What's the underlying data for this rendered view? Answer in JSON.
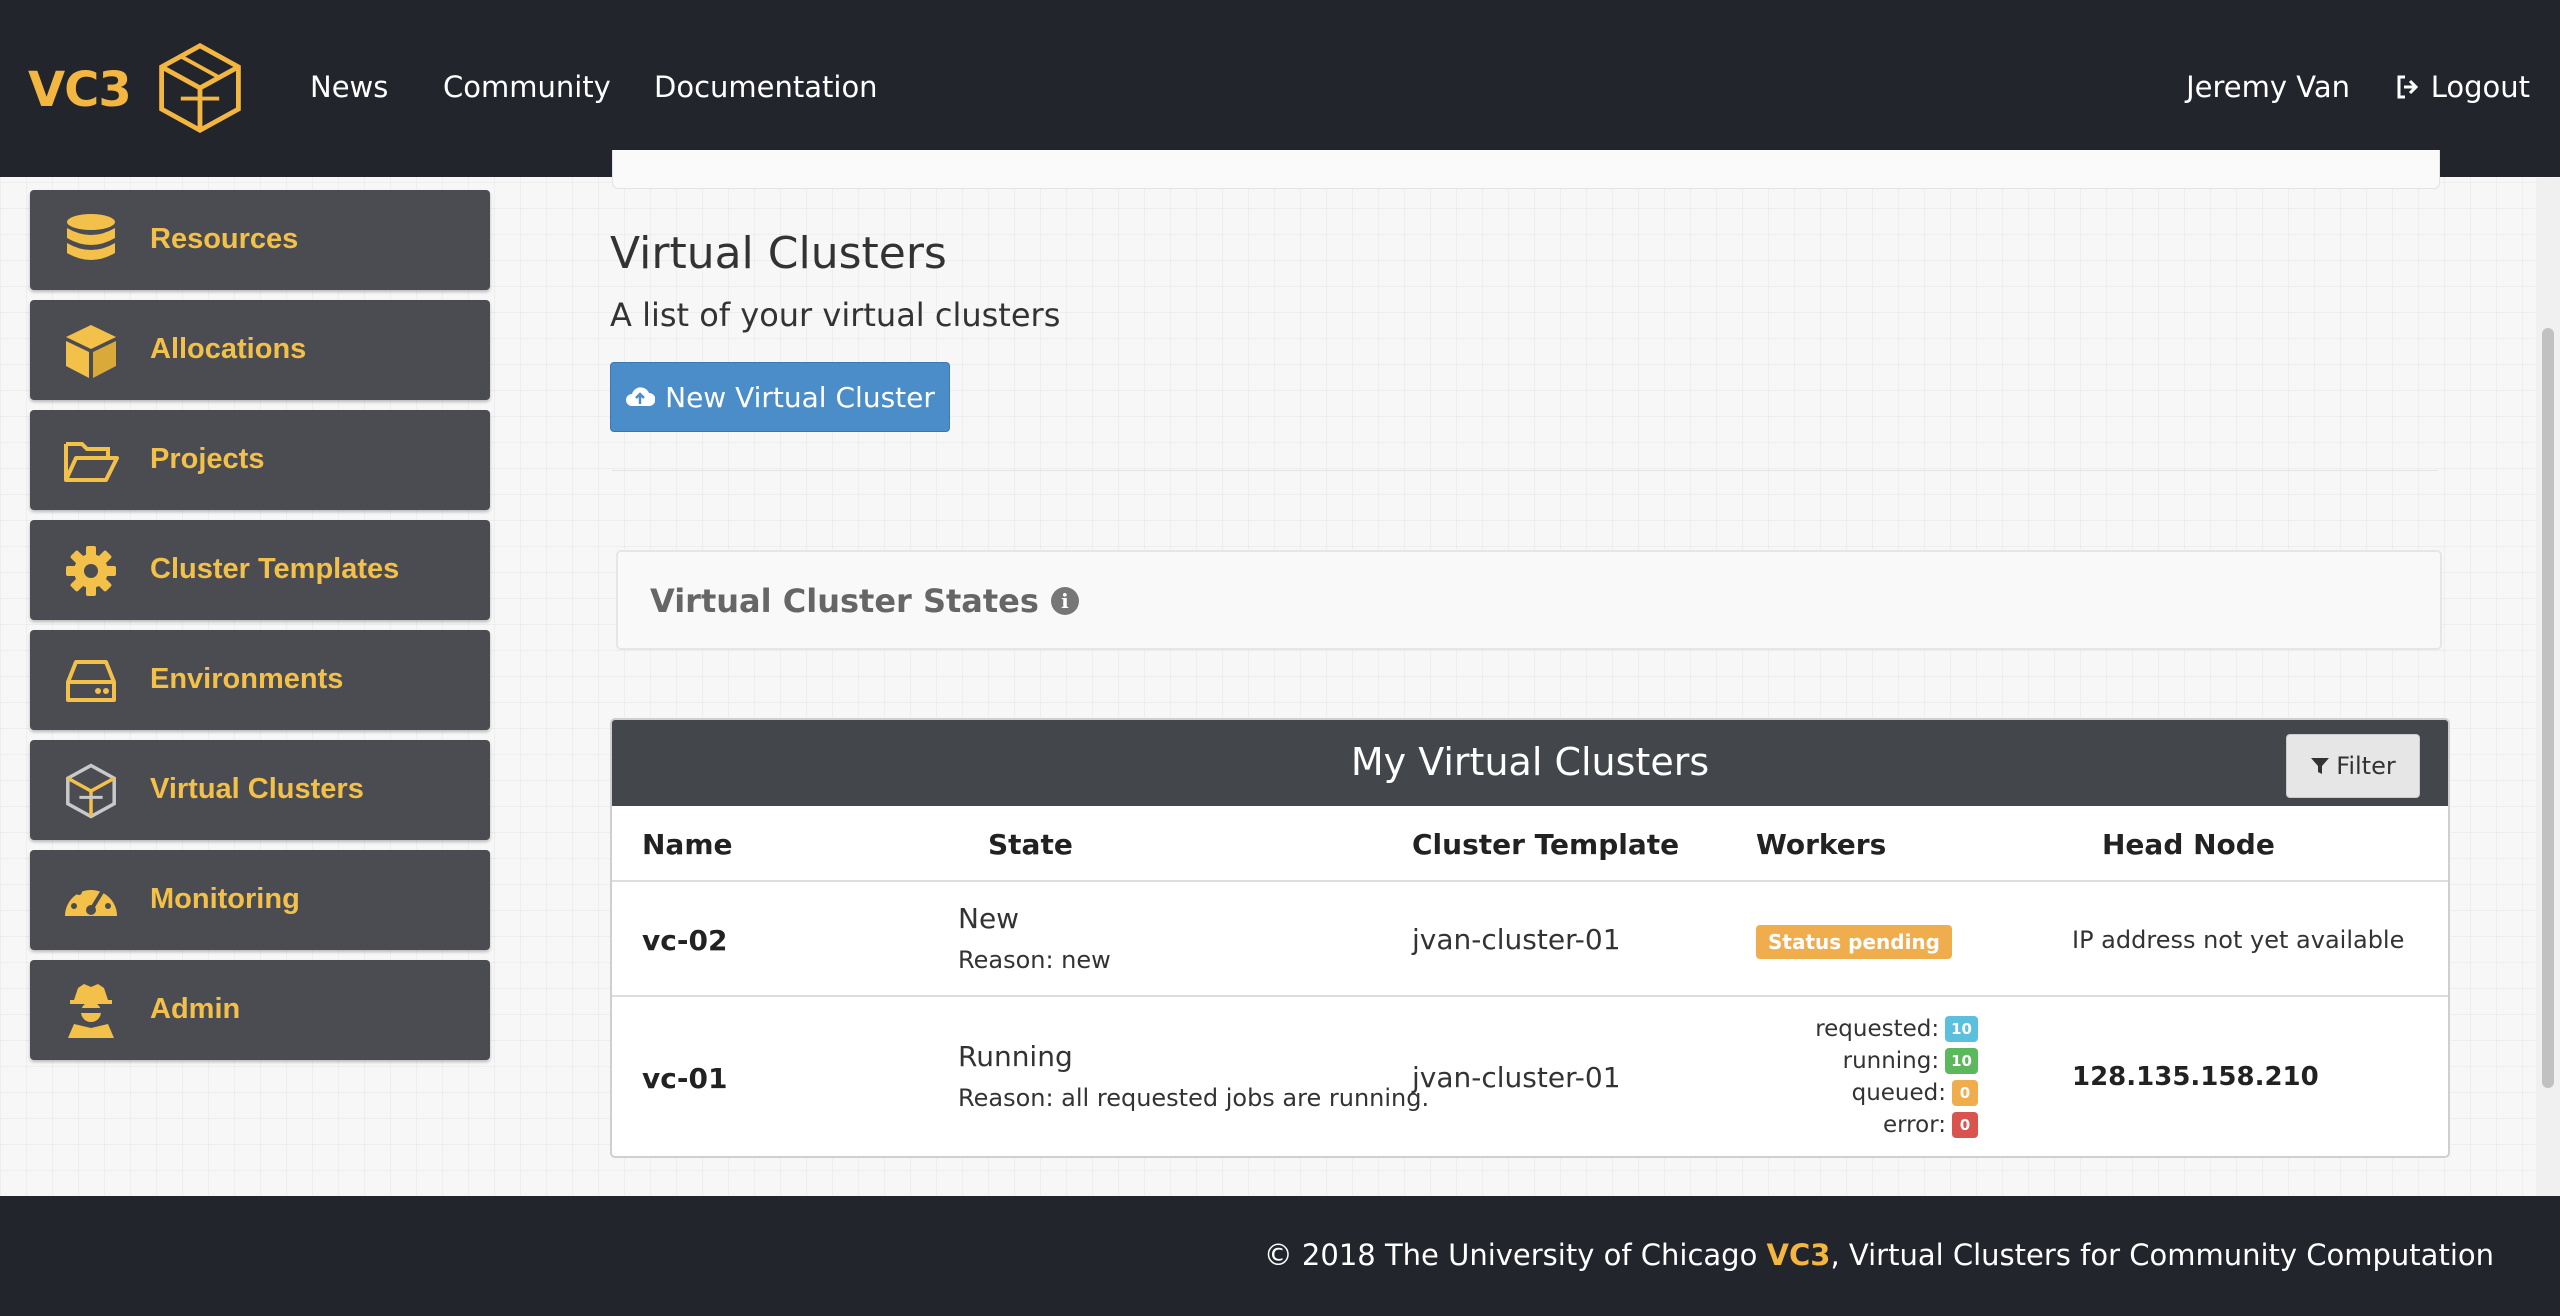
{
  "header": {
    "brand": "VC3",
    "nav": [
      "News",
      "Community",
      "Documentation"
    ],
    "user": "Jeremy Van",
    "logout": "Logout"
  },
  "sidebar": {
    "items": [
      {
        "label": "Resources",
        "icon": "database-icon"
      },
      {
        "label": "Allocations",
        "icon": "cube-icon"
      },
      {
        "label": "Projects",
        "icon": "folder-open-icon"
      },
      {
        "label": "Cluster Templates",
        "icon": "gear-icon"
      },
      {
        "label": "Environments",
        "icon": "hard-drive-icon"
      },
      {
        "label": "Virtual Clusters",
        "icon": "vc3-logo-icon"
      },
      {
        "label": "Monitoring",
        "icon": "dashboard-icon"
      },
      {
        "label": "Admin",
        "icon": "user-secret-icon"
      }
    ]
  },
  "main": {
    "title": "Virtual Clusters",
    "subtitle": "A list of your virtual clusters",
    "new_button": "New Virtual Cluster",
    "states_title": "Virtual Cluster States"
  },
  "table": {
    "title": "My Virtual Clusters",
    "filter": "Filter",
    "columns": [
      "Name",
      "State",
      "Cluster Template",
      "Workers",
      "Head Node"
    ],
    "rows": [
      {
        "name": "vc-02",
        "state": "New",
        "reason": "Reason: new",
        "template": "jvan-cluster-01",
        "workers_badge": "Status pending",
        "head_node": "IP address not yet available"
      },
      {
        "name": "vc-01",
        "state": "Running",
        "reason": "Reason: all requested jobs are running.",
        "template": "jvan-cluster-01",
        "workers": [
          {
            "label": "requested:",
            "value": "10",
            "color": "#5bc0de"
          },
          {
            "label": "running:",
            "value": "10",
            "color": "#5cb85c"
          },
          {
            "label": "queued:",
            "value": "0",
            "color": "#f0ad4e"
          },
          {
            "label": "error:",
            "value": "0",
            "color": "#d9534f"
          }
        ],
        "head_node": "128.135.158.210"
      }
    ]
  },
  "footer": {
    "prefix": "© 2018 The University of Chicago ",
    "brand": "VC3",
    "suffix": ", Virtual Clusters for Community Computation"
  },
  "colors": {
    "accent": "#f3b641",
    "nav_bg": "#23252d",
    "sidebar_bg": "#4b4c51",
    "primary_button": "#4b8dc8"
  }
}
